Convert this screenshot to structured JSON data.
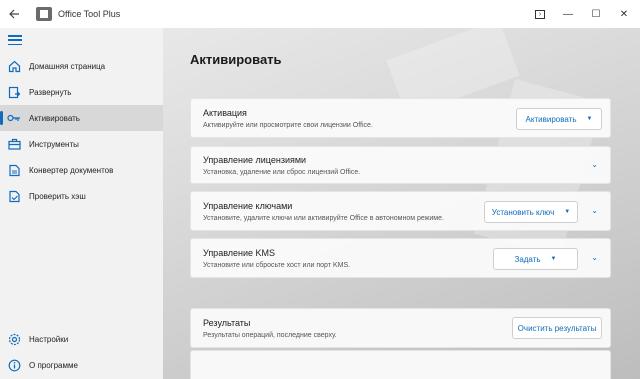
{
  "titlebar": {
    "app_title": "Office Tool Plus",
    "back_icon": "back-arrow-icon",
    "app_icon": "office-tool-plus-logo",
    "terminal_icon": "terminal-icon",
    "minimize_glyph": "—",
    "maximize_glyph": "☐",
    "close_glyph": "✕"
  },
  "sidebar": {
    "menu_icon": "hamburger-menu-icon",
    "items": [
      {
        "label": "Домашняя страница",
        "icon": "home-icon",
        "active": false
      },
      {
        "label": "Развернуть",
        "icon": "deploy-icon",
        "active": false
      },
      {
        "label": "Активировать",
        "icon": "key-icon",
        "active": true
      },
      {
        "label": "Инструменты",
        "icon": "toolbox-icon",
        "active": false
      },
      {
        "label": "Конвертер документов",
        "icon": "document-convert-icon",
        "active": false
      },
      {
        "label": "Проверить хэш",
        "icon": "hash-check-icon",
        "active": false
      }
    ],
    "bottom_items": [
      {
        "label": "Настройки",
        "icon": "gear-icon"
      },
      {
        "label": "О программе",
        "icon": "info-icon"
      }
    ]
  },
  "main": {
    "title": "Активировать",
    "cards": [
      {
        "title": "Активация",
        "desc": "Активируйте или просмотрите свои лицензии Office.",
        "button": "Активировать"
      },
      {
        "title": "Управление лицензиями",
        "desc": "Установка, удаление или сброс лицензий Office."
      },
      {
        "title": "Управление ключами",
        "desc": "Установите, удалите ключи или активируйте Office в автономном режиме.",
        "button": "Установить ключ"
      },
      {
        "title": "Управление KMS",
        "desc": "Установите или сбросьте хост или порт KMS.",
        "button": "Задать"
      },
      {
        "title": "Результаты",
        "desc": "Результаты операций, последние сверху.",
        "button": "Очистить результаты"
      }
    ]
  },
  "colors": {
    "accent": "#0f6cbd",
    "active_nav_bg": "#d8d8d8",
    "sidebar_bg": "#f2f2f2"
  }
}
